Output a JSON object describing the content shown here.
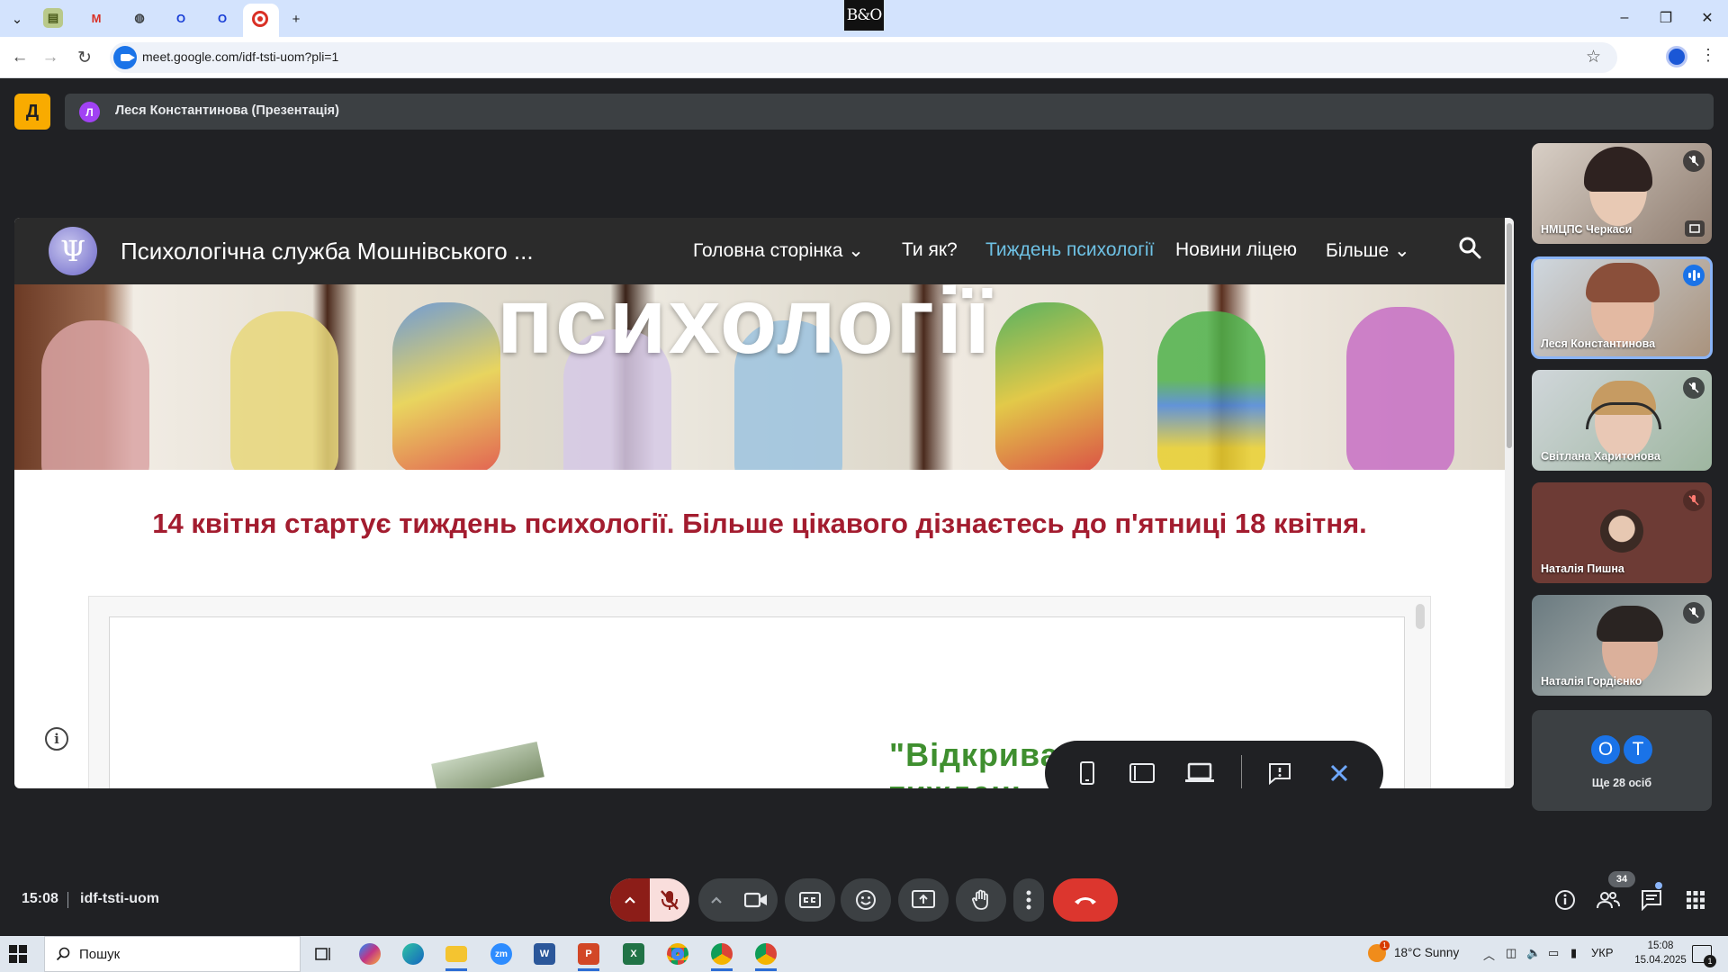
{
  "browser": {
    "url": "meet.google.com/idf-tsti-uom?pli=1",
    "tab_add": "+",
    "window_minimize": "–",
    "window_restore": "❐",
    "window_close": "✕",
    "bo_logo": "B&O"
  },
  "meet": {
    "presenter_initial": "Л",
    "presenter_label": "Леся Константинова (Презентація)",
    "time": "15:08",
    "meeting_code": "idf-tsti-uom",
    "participants_count": "34"
  },
  "site": {
    "title": "Психологічна служба Мошнівського ...",
    "menu": [
      {
        "label": "Головна сторінка",
        "has_dropdown": true
      },
      {
        "label": "Ти як?",
        "has_dropdown": false
      },
      {
        "label": "Тиждень психології",
        "active": true
      },
      {
        "label": "Новини ліцею",
        "has_dropdown": false
      },
      {
        "label": "Більше",
        "has_dropdown": true
      }
    ],
    "banner_title": "психології",
    "headline": "14 квітня стартує тиждень психології. Більше цікавого дізнаєтесь до п'ятниці 18 квітня.",
    "embed_text": "\"Відкриваю свій колір: тиждень"
  },
  "participants": [
    {
      "name": "НМЦПС Черкаси",
      "muted": true,
      "speaking": false
    },
    {
      "name": "Леся Константинова",
      "muted": false,
      "speaking": true
    },
    {
      "name": "Світлана Харитонова",
      "muted": true,
      "speaking": false
    },
    {
      "name": "Наталія Пишна",
      "muted": true,
      "speaking": false
    },
    {
      "name": "Наталія Гордієнко",
      "muted": true,
      "speaking": false
    }
  ],
  "more": {
    "avatars": [
      "О",
      "Т"
    ],
    "label": "Ще 28 осіб"
  },
  "taskbar": {
    "search_placeholder": "Пошук",
    "weather": "18°C  Sunny",
    "weather_badge": "1",
    "language": "УКР",
    "time": "15:08",
    "date": "15.04.2025",
    "notification_count": "1"
  },
  "colors": {
    "accent": "#1a73e8",
    "hangup": "#dc362e",
    "headline": "#a31c2f",
    "active_menu": "#6ec1e4"
  }
}
